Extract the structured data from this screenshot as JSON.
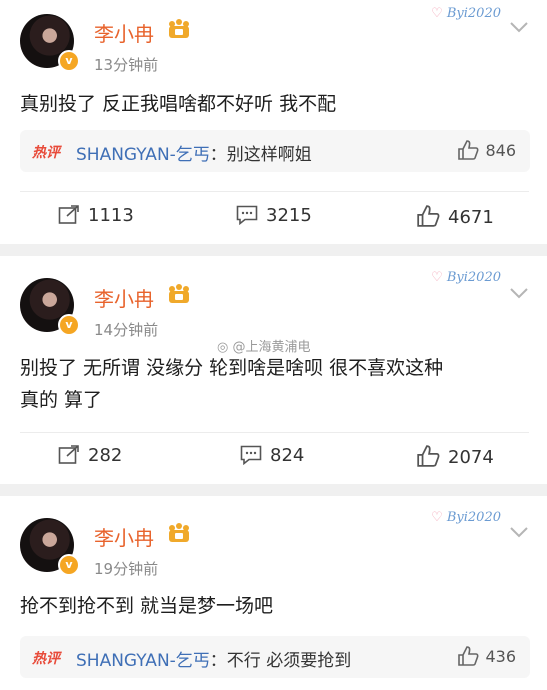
{
  "posts": [
    {
      "username": "李小冉",
      "time": "13分钟前",
      "watermark": "Byi2020",
      "body": "真别投了 反正我唱啥都不好听 我不配",
      "hot_comment": {
        "tag": "热评",
        "user": "SHANGYAN-乞丐",
        "text": "别这样啊姐",
        "likes": "846"
      },
      "actions": {
        "reposts": "1113",
        "comments": "3215",
        "likes": "4671"
      }
    },
    {
      "username": "李小冉",
      "time": "14分钟前",
      "watermark": "Byi2020",
      "body_lines": [
        "别投了 无所谓 没缘分 轮到啥是啥呗 很不喜欢这种",
        "真的  算了"
      ],
      "actions": {
        "reposts": "282",
        "comments": "824",
        "likes": "2074"
      }
    },
    {
      "username": "李小冉",
      "time": "19分钟前",
      "watermark": "Byi2020",
      "body": "抢不到抢不到 就当是梦一场吧",
      "hot_comment": {
        "tag": "热评",
        "user": "SHANGYAN-乞丐",
        "text": "不行 必须要抢到",
        "likes": "436"
      }
    }
  ],
  "weibo_watermark": "@上海黄浦电"
}
